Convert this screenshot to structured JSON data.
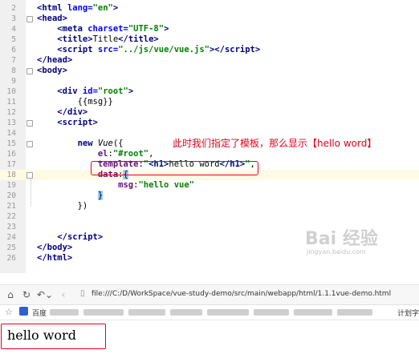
{
  "editor": {
    "lines": [
      {
        "n": "2",
        "html": "<span class=\"tag\">&lt;html</span> <span class=\"attr\">lang=</span><span class=\"str\">\"en\"</span><span class=\"tag\">&gt;</span>"
      },
      {
        "n": "3",
        "html": "<span class=\"tag\">&lt;head&gt;</span>"
      },
      {
        "n": "4",
        "html": "    <span class=\"tag\">&lt;meta</span> <span class=\"attr\">charset=</span><span class=\"str\">\"UTF-8\"</span><span class=\"tag\">&gt;</span>"
      },
      {
        "n": "5",
        "html": "    <span class=\"tag\">&lt;title&gt;</span><span class=\"plain\">Title</span><span class=\"tag\">&lt;/title&gt;</span>"
      },
      {
        "n": "6",
        "html": "    <span class=\"tag\">&lt;script</span> <span class=\"attr\">src=</span><span class=\"str\">\"../js/vue/vue.js\"</span><span class=\"tag\">&gt;&lt;/script&gt;</span>"
      },
      {
        "n": "7",
        "html": "<span class=\"tag\">&lt;/head&gt;</span>"
      },
      {
        "n": "8",
        "html": "<span class=\"tag\">&lt;body&gt;</span>"
      },
      {
        "n": "9",
        "html": ""
      },
      {
        "n": "10",
        "html": "    <span class=\"tag\">&lt;div</span> <span class=\"attr\">id=</span><span class=\"str\">\"root\"</span><span class=\"tag\">&gt;</span>"
      },
      {
        "n": "11",
        "html": "        <span class=\"plain\">{{msg}}</span>"
      },
      {
        "n": "12",
        "html": "    <span class=\"tag\">&lt;/div&gt;</span>"
      },
      {
        "n": "13",
        "html": "    <span class=\"tag\">&lt;script&gt;</span>"
      },
      {
        "n": "14",
        "html": ""
      },
      {
        "n": "15",
        "html": "        <span class=\"kw\">new</span> <span class=\"fn\">Vue</span><span class=\"plain\">({</span>"
      },
      {
        "n": "16",
        "html": "            <span class=\"prop\">el</span><span class=\"plain\">:</span><span class=\"str\">\"#root\"</span><span class=\"plain\">,</span>"
      },
      {
        "n": "17",
        "html": "            <span class=\"prop\">template</span><span class=\"plain\">:</span><span class=\"str\">\"</span><span class=\"tag\">&lt;h1&gt;</span><span class=\"plain\">hello word</span><span class=\"tag\">&lt;/h1&gt;</span><span class=\"str\">\"</span><span class=\"plain\">,</span>"
      },
      {
        "n": "18",
        "html": "            <span class=\"prop\">data</span><span class=\"plain\">:</span><span class=\"brace-hl\">{</span>",
        "current": true
      },
      {
        "n": "19",
        "html": "                <span class=\"prop\">msg</span><span class=\"plain\">:</span><span class=\"str\">\"hello vue\"</span>"
      },
      {
        "n": "20",
        "html": "            <span class=\"brace-hl\">}</span>"
      },
      {
        "n": "21",
        "html": "        <span class=\"plain\">})</span>"
      },
      {
        "n": "22",
        "html": ""
      },
      {
        "n": "23",
        "html": ""
      },
      {
        "n": "24",
        "html": "    <span class=\"tag\">&lt;/script&gt;</span>"
      },
      {
        "n": "25",
        "html": "<span class=\"tag\">&lt;/body&gt;</span>"
      },
      {
        "n": "26",
        "html": "<span class=\"tag\">&lt;/html&gt;</span>"
      }
    ],
    "annotation": "此时我们指定了模板，那么显示【hello word】",
    "watermark_logo": "Bai 经验",
    "watermark_sub": "jingyan.baidu.com"
  },
  "browser": {
    "back_icon": "back-arrow-icon",
    "url": "file:///C:/D/WorkSpace/vue-study-demo/src/main/webapp/html/1.1.1vue-demo.html",
    "bookmark_first": "百度",
    "bookmark_right": "计划字",
    "page_text": "hello word"
  }
}
